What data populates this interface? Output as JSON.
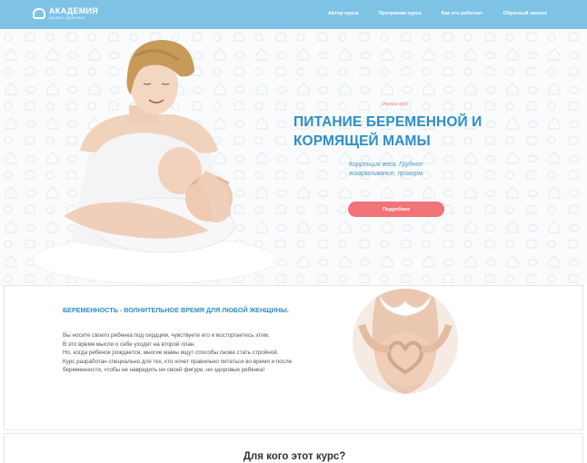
{
  "header": {
    "logo_title": "АКАДЕМИЯ",
    "logo_subtitle": "ВАШЕГО ЗДОРОВЬЯ",
    "nav": [
      "Автор курса",
      "Программа курса",
      "Как это работает",
      "Обратный звонок"
    ]
  },
  "hero": {
    "online_label": "Онлайн курс",
    "title": "ПИТАНИЕ БЕРЕМЕННОЙ И КОРМЯЩЕЙ МАМЫ",
    "subtitle": "Коррекция веса. Грудное вскармливание, прикорм",
    "cta_label": "Подробнее"
  },
  "intro": {
    "title": "БЕРЕМЕННОСТЬ - ВОЛНИТЕЛЬНОЕ ВРЕМЯ ДЛЯ ЛЮБОЙ ЖЕНЩИНЫ.",
    "paragraphs": [
      "Вы носите своего ребенка под сердцем, чувствуете его и восторгаетесь этим.",
      "В это время мысли о себе уходят на второй план.",
      "Но, когда ребенок рождается, многие мамы ищут способы снова стать стройной.",
      "Курс разработан специально для тех, кто хочет правильно питаться во время и после беременности, чтобы не навредить ни своей фигуре, ни здоровью ребенка!"
    ]
  },
  "audience": {
    "title": "Для кого этот курс?"
  },
  "colors": {
    "header_bg": "#7ec3e6",
    "accent_blue": "#2b8fc9",
    "cta": "#f07478",
    "online_label": "#f07d7d"
  }
}
